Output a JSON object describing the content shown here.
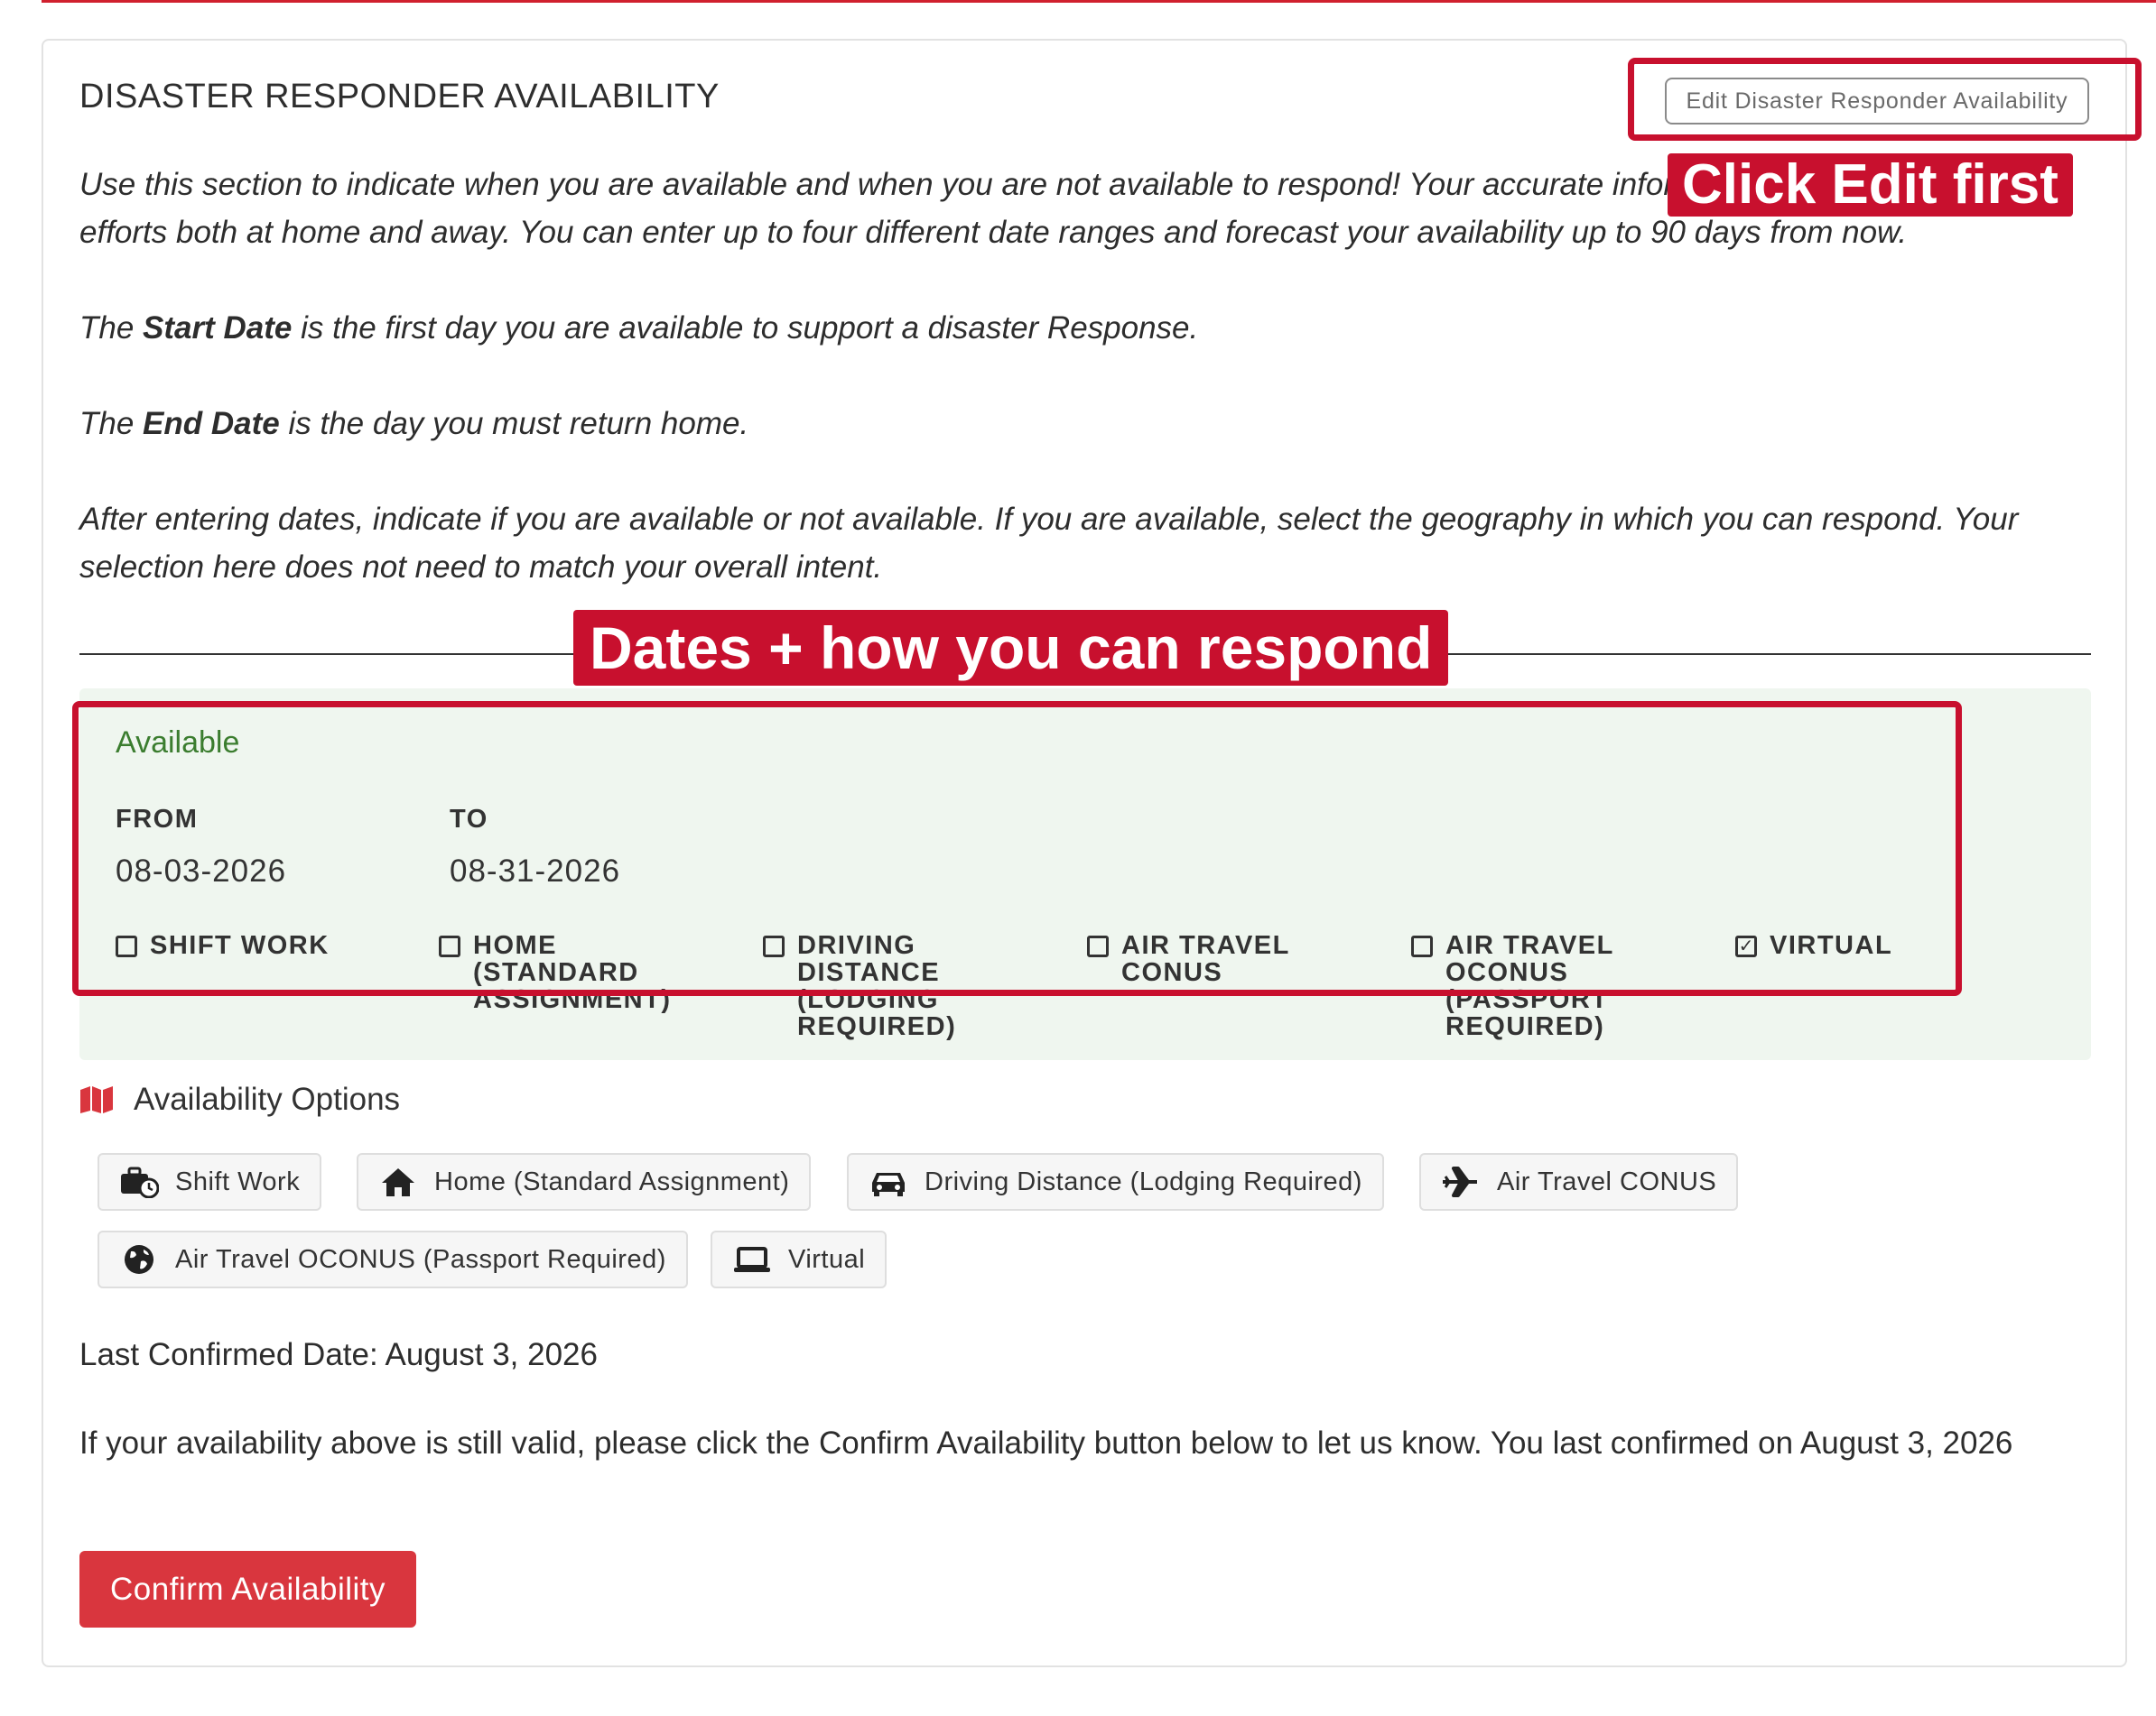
{
  "section": {
    "title": "DISASTER RESPONDER AVAILABILITY",
    "edit_button": "Edit Disaster Responder Availability"
  },
  "intro": {
    "p1": "Use this section to indicate when you are available and when you are not available to respond! Your accurate information supports response efforts both at home and away. You can enter up to four different date ranges and forecast your availability up to 90 days from now.",
    "p2_prefix": "The ",
    "p2_bold": "Start Date",
    "p2_suffix": " is the first day you are available to support a disaster Response.",
    "p3_prefix": "The ",
    "p3_bold": "End Date",
    "p3_suffix": " is the day you must return home.",
    "p4": "After entering dates, indicate if you are available or not available. If you are available, select the geography in which you can respond. Your selection here does not need to match your overall intent."
  },
  "availability": {
    "status": "Available",
    "from_label": "FROM",
    "to_label": "TO",
    "from_value": "08-03-2026",
    "to_value": "08-31-2026",
    "checkboxes": [
      {
        "label": "SHIFT WORK",
        "checked": false
      },
      {
        "label": "HOME (STANDARD ASSIGNMENT)",
        "checked": false
      },
      {
        "label": "DRIVING DISTANCE (LODGING REQUIRED)",
        "checked": false
      },
      {
        "label": "AIR TRAVEL CONUS",
        "checked": false
      },
      {
        "label": "AIR TRAVEL OCONUS (PASSPORT REQUIRED)",
        "checked": false
      },
      {
        "label": "VIRTUAL",
        "checked": true
      }
    ]
  },
  "options": {
    "heading": "Availability Options",
    "chips": [
      {
        "label": "Shift Work",
        "icon": "briefcase-clock-icon"
      },
      {
        "label": "Home (Standard Assignment)",
        "icon": "home-icon"
      },
      {
        "label": "Driving Distance (Lodging Required)",
        "icon": "car-icon"
      },
      {
        "label": "Air Travel CONUS",
        "icon": "plane-icon"
      },
      {
        "label": "Air Travel OCONUS (Passport Required)",
        "icon": "globe-icon"
      },
      {
        "label": "Virtual",
        "icon": "laptop-icon"
      }
    ]
  },
  "confirmation": {
    "last_confirmed": "Last Confirmed Date: August 3, 2026",
    "note": "If your availability above is still valid, please click the Confirm Availability button below to let us know. You last confirmed on August 3, 2026",
    "button": "Confirm Availability"
  },
  "annotations": {
    "edit_callout": "Click Edit first",
    "dates_callout": "Dates + how you can respond"
  },
  "colors": {
    "accent_red": "#c8102e",
    "button_red": "#d9363e",
    "available_green": "#3b7d2f",
    "panel_green": "#eff6ef"
  }
}
